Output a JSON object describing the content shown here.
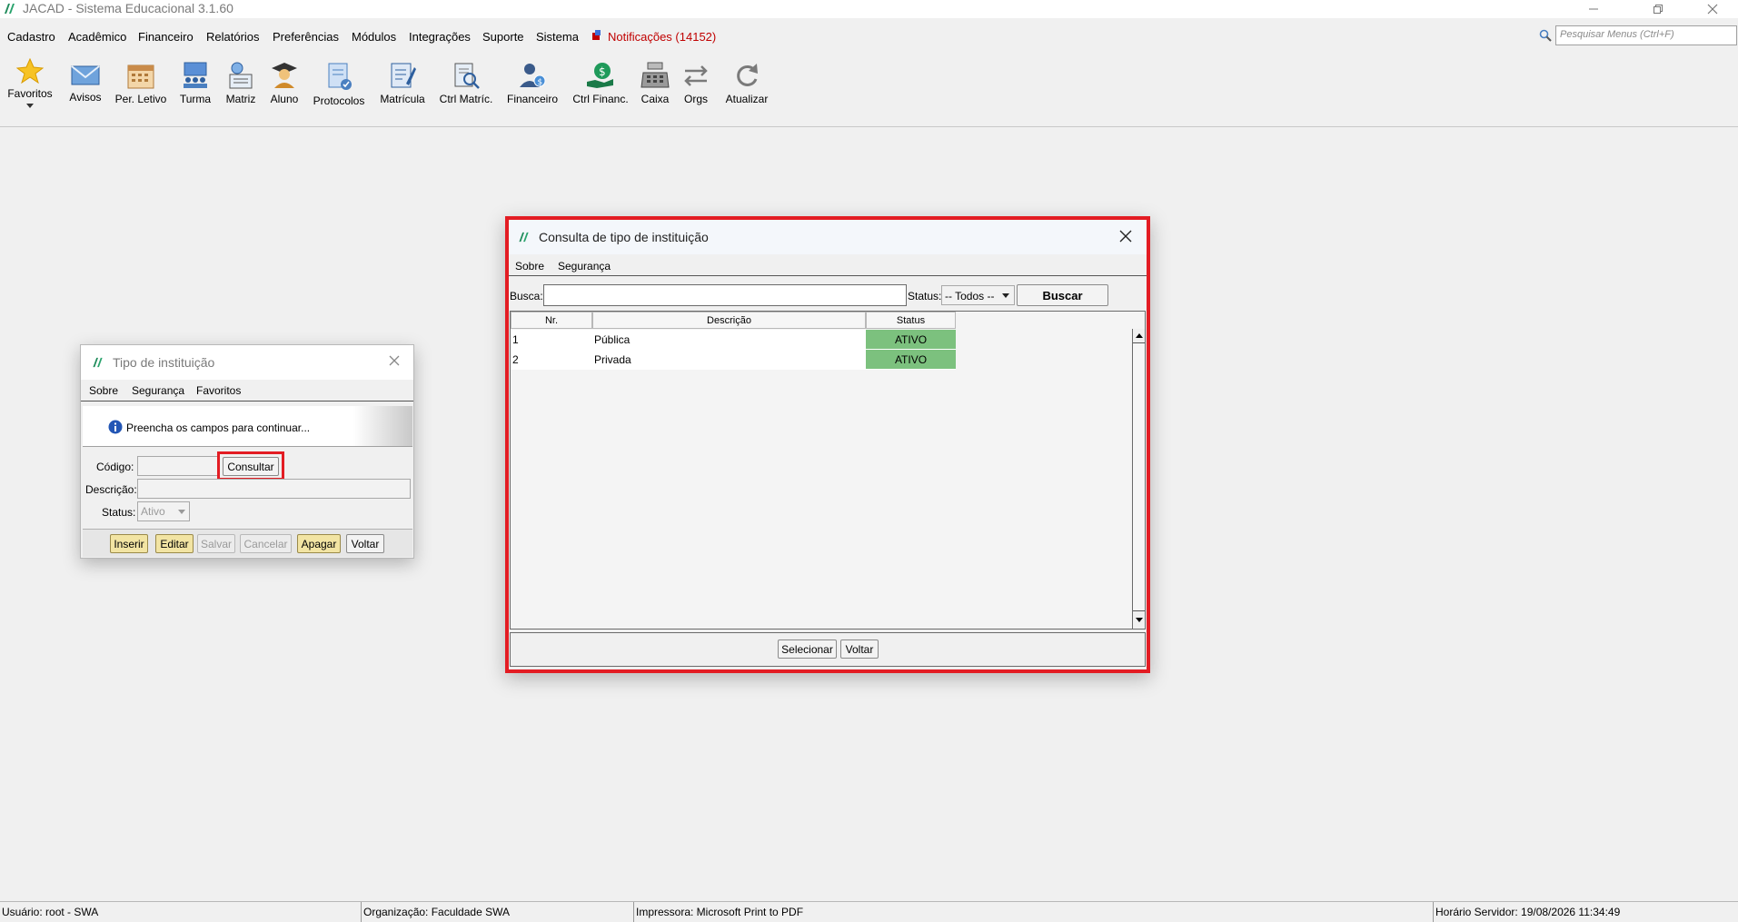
{
  "window": {
    "title": "JACAD - Sistema Educacional 3.1.60"
  },
  "menubar": {
    "items": [
      "Cadastro",
      "Acadêmico",
      "Financeiro",
      "Relatórios",
      "Preferências",
      "Módulos",
      "Integrações",
      "Suporte",
      "Sistema"
    ],
    "notifications": "Notificações (14152)",
    "search_placeholder": "Pesquisar Menus (Ctrl+F)"
  },
  "toolbar": {
    "favoritos": "Favoritos",
    "avisos": "Avisos",
    "per_letivo": "Per. Letivo",
    "turma": "Turma",
    "matriz": "Matriz",
    "aluno": "Aluno",
    "protocolos": "Protocolos",
    "matricula": "Matrícula",
    "ctrl_matric": "Ctrl Matríc.",
    "financeiro": "Financeiro",
    "ctrl_financ": "Ctrl Financ.",
    "caixa": "Caixa",
    "orgs": "Orgs",
    "atualizar": "Atualizar"
  },
  "tipo_dialog": {
    "title": "Tipo de instituição",
    "menu": [
      "Sobre",
      "Segurança",
      "Favoritos"
    ],
    "info": "Preencha os campos para continuar...",
    "codigo_label": "Código:",
    "codigo_value": "",
    "consultar": "Consultar",
    "descricao_label": "Descrição:",
    "descricao_value": "",
    "status_label": "Status:",
    "status_value": "Ativo",
    "buttons": {
      "inserir": "Inserir",
      "editar": "Editar",
      "salvar": "Salvar",
      "cancelar": "Cancelar",
      "apagar": "Apagar",
      "voltar": "Voltar"
    }
  },
  "consulta_dialog": {
    "title": "Consulta de tipo de instituição",
    "menu": [
      "Sobre",
      "Segurança"
    ],
    "busca_label": "Busca:",
    "busca_value": "",
    "status_label": "Status:",
    "status_value": "-- Todos --",
    "buscar": "Buscar",
    "columns": [
      "Nr.",
      "Descrição",
      "Status"
    ],
    "rows": [
      {
        "nr": "1",
        "descricao": "Pública",
        "status": "ATIVO"
      },
      {
        "nr": "2",
        "descricao": "Privada",
        "status": "ATIVO"
      }
    ],
    "selecionar": "Selecionar",
    "voltar": "Voltar"
  },
  "statusbar": {
    "usuario": "Usuário: root - SWA",
    "organizacao": "Organização: Faculdade SWA",
    "impressora": "Impressora: Microsoft Print to PDF",
    "horario": "Horário Servidor: 19/08/2026 11:34:49"
  },
  "colors": {
    "highlight": "#e31c23",
    "active_badge": "#7cc17e",
    "notification": "#c00000",
    "yellow_button": "#f2e4a3"
  }
}
